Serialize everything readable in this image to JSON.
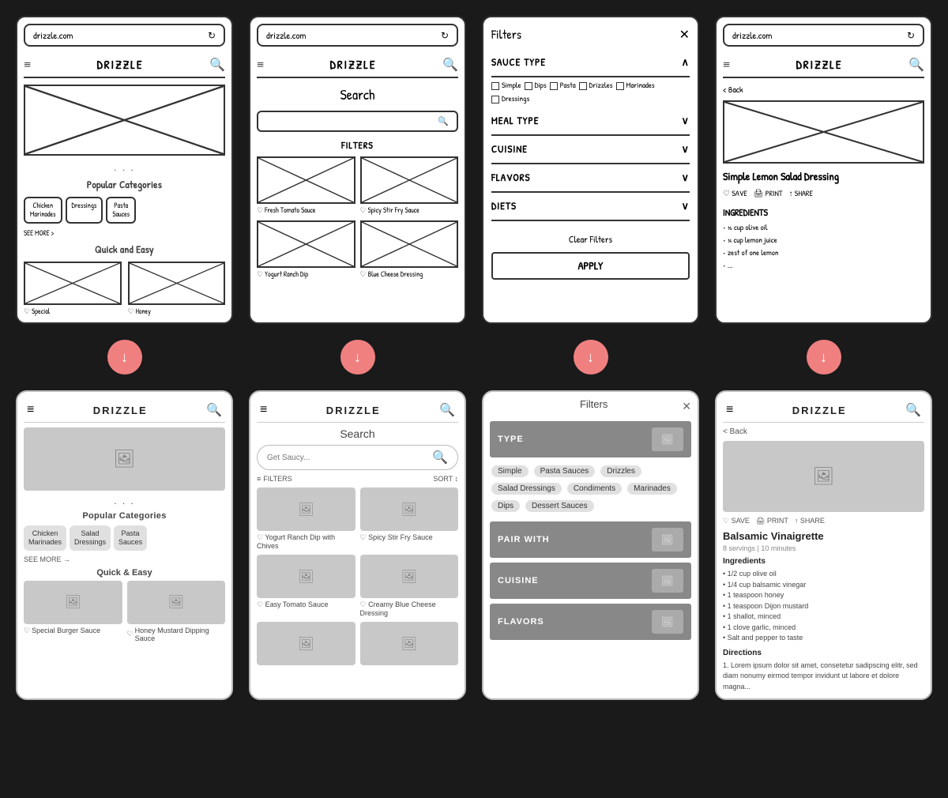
{
  "rows": {
    "top": [
      {
        "type": "wireframe",
        "page": "home",
        "browser_url": "drizzle.com",
        "header_menu": "≡",
        "header_title": "DRIZZLE",
        "header_search": "🔍",
        "popular_title": "Popular Categories",
        "categories": [
          "Chicken Marinades",
          "Dressings",
          "Pasta Sauces"
        ],
        "see_more": "SEE MORE >",
        "quick_title": "Quick and Easy",
        "quick_items": [
          "Special",
          "Honey"
        ]
      },
      {
        "type": "wireframe",
        "page": "search",
        "browser_url": "drizzle.com",
        "header_menu": "≡",
        "header_title": "DRIZZLE",
        "header_search": "🔍",
        "search_title": "Search",
        "filters_label": "FILTERS",
        "recipes": [
          {
            "label": "♡ Fresh Tomato Sauce"
          },
          {
            "label": "♡ Spicy Stir Fry Sauce"
          },
          {
            "label": "♡ Yogurt Ranch Dip"
          },
          {
            "label": "♡ Blue Cheese Dressing"
          }
        ]
      },
      {
        "type": "wireframe",
        "page": "filters",
        "title": "Filters",
        "close": "✕",
        "sections": [
          {
            "label": "SAUCE TYPE",
            "icon": "∧",
            "expanded": true,
            "options": [
              "Simple",
              "Dips",
              "Pasta",
              "Drizzles",
              "Marinades",
              "Dressings"
            ]
          },
          {
            "label": "MEAL TYPE",
            "icon": "∨",
            "expanded": false
          },
          {
            "label": "CUISINE",
            "icon": "∨",
            "expanded": false
          },
          {
            "label": "FLAVORS",
            "icon": "∨",
            "expanded": false
          },
          {
            "label": "DIETS",
            "icon": "∨",
            "expanded": false
          }
        ],
        "clear_btn": "Clear Filters",
        "apply_btn": "APPLY"
      },
      {
        "type": "wireframe",
        "page": "detail",
        "browser_url": "drizzle.com",
        "header_menu": "≡",
        "header_title": "DRIZZLE",
        "header_search": "🔍",
        "back": "< Back",
        "recipe_title": "Simple Lemon Salad Dressing",
        "actions": [
          "♡ SAVE",
          "🖨 PRINT",
          "↑ SHARE"
        ],
        "ingredients_title": "INGREDIENTS",
        "ingredients": [
          "½ cup olive oil",
          "¼ cup lemon juice",
          "zest of one lemon"
        ]
      }
    ],
    "bottom": [
      {
        "type": "real",
        "page": "home",
        "header_menu": "≡",
        "header_title": "DRIZZLE",
        "header_search": "🔍",
        "popular_title": "Popular Categories",
        "categories": [
          "Chicken Marinades",
          "Salad Dressings",
          "Pasta Sauces"
        ],
        "see_more": "SEE MORE →",
        "quick_title": "Quick & Easy",
        "quick_items": [
          {
            "label": "♡ Special Burger Sauce"
          },
          {
            "label": "♡ Honey Mustard Dipping Sauce"
          }
        ]
      },
      {
        "type": "real",
        "page": "search",
        "header_menu": "≡",
        "header_title": "DRIZZLE",
        "header_search": "🔍",
        "search_title": "Search",
        "search_placeholder": "Get Saucy...",
        "filters_label": "FILTERS",
        "sort_label": "SORT ↕",
        "recipes": [
          {
            "label": "♡ Yogurt Ranch Dip with Chives"
          },
          {
            "label": "♡ Spicy Stir Fry Sauce"
          },
          {
            "label": "♡ Easy Tomato Sauce"
          },
          {
            "label": "♡ Creamy Blue Cheese Dressing"
          }
        ]
      },
      {
        "type": "real",
        "page": "filters",
        "title": "Filters",
        "close": "✕",
        "sections": [
          {
            "label": "TYPE",
            "tags": [
              "Simple",
              "Pasta Sauces",
              "Drizzles",
              "Salad Dressings",
              "Condiments",
              "Marinades",
              "Dips",
              "Dessert Sauces"
            ]
          },
          {
            "label": "PAIR WITH"
          },
          {
            "label": "CUISINE"
          },
          {
            "label": "FLAVORS"
          }
        ]
      },
      {
        "type": "real",
        "page": "detail",
        "header_menu": "≡",
        "header_title": "DRIZZLE",
        "header_search": "🔍",
        "back": "< Back",
        "recipe_title": "Balsamic Vinaigrette",
        "recipe_meta": "8 servings | 10 minutes",
        "actions": [
          "♡ SAVE",
          "🖨 PRINT",
          "↑ SHARE"
        ],
        "ingredients_title": "Ingredients",
        "ingredients": [
          "• 1/2 cup olive oil",
          "• 1/4 cup balsamic vinegar",
          "• 1 teaspoon honey",
          "• 1 teaspoon Dijon mustard",
          "• 1 shallot, minced",
          "• 1 clove garlic, minced",
          "• Salt and pepper to taste"
        ],
        "directions_title": "Directions",
        "directions": "1. Lorem ipsum dolor sit amet, consetetur sadipscing elitr, sed diam nonumy eirmod tempor invidunt ut labore et dolore magna..."
      }
    ]
  },
  "arrows": [
    "↓",
    "↓",
    "↓",
    "↓"
  ],
  "arrow_color": "#f08080"
}
